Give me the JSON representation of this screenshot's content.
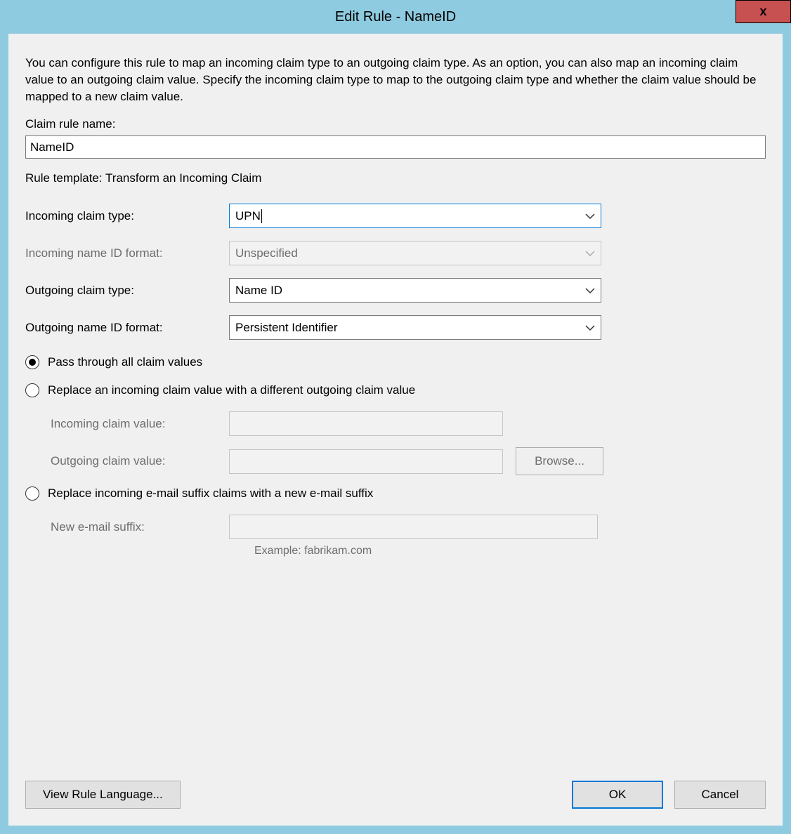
{
  "window": {
    "title": "Edit Rule - NameID",
    "close_label": "x"
  },
  "description": "You can configure this rule to map an incoming claim type to an outgoing claim type. As an option, you can also map an incoming claim value to an outgoing claim value. Specify the incoming claim type to map to the outgoing claim type and whether the claim value should be mapped to a new claim value.",
  "labels": {
    "claim_rule_name": "Claim rule name:",
    "rule_template_prefix": "Rule template: ",
    "rule_template_value": "Transform an Incoming Claim",
    "incoming_claim_type": "Incoming claim type:",
    "incoming_name_id_format": "Incoming name ID format:",
    "outgoing_claim_type": "Outgoing claim type:",
    "outgoing_name_id_format": "Outgoing name ID format:",
    "incoming_claim_value": "Incoming claim value:",
    "outgoing_claim_value": "Outgoing claim value:",
    "new_email_suffix": "New e-mail suffix:",
    "example": "Example: fabrikam.com"
  },
  "fields": {
    "claim_rule_name": "NameID",
    "incoming_claim_type": "UPN",
    "incoming_name_id_format": "Unspecified",
    "outgoing_claim_type": "Name ID",
    "outgoing_name_id_format": "Persistent Identifier",
    "incoming_claim_value": "",
    "outgoing_claim_value": "",
    "new_email_suffix": ""
  },
  "radios": {
    "pass_through": "Pass through all claim values",
    "replace_value": "Replace an incoming claim value with a different outgoing claim value",
    "replace_suffix": "Replace incoming e-mail suffix claims with a new e-mail suffix",
    "selected": "pass_through"
  },
  "buttons": {
    "browse": "Browse...",
    "view_rule_language": "View Rule Language...",
    "ok": "OK",
    "cancel": "Cancel"
  }
}
